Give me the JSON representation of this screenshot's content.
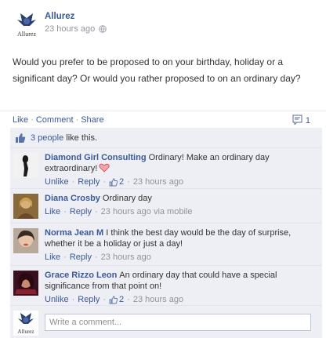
{
  "post": {
    "author": "Allurez",
    "avatar_wordmark": "Allurez",
    "time": "23 hours ago",
    "privacy_icon": "globe-icon",
    "body": "Would you prefer to be proposed to on your birthday, holiday or a significant day? Or would you rather proposed to on an ordinary day?"
  },
  "actions": {
    "like": "Like",
    "comment": "Comment",
    "share": "Share",
    "separator": "·",
    "comment_count": "1",
    "comment_count_icon": "comment-bubble-icon"
  },
  "likes": {
    "icon": "thumbs-up-icon",
    "people": "3 people",
    "suffix": "like this."
  },
  "comments": [
    {
      "author": "Diamond Girl Consulting",
      "text": "Ordinary! Make an ordinary day extraordinary!",
      "emoticon": "heart-icon",
      "actions": [
        "Unlike",
        "Reply"
      ],
      "like_count": "2",
      "time": "23 hours ago",
      "via": ""
    },
    {
      "author": "Diana Crosby",
      "text": "Ordinary day",
      "actions": [
        "Like",
        "Reply"
      ],
      "like_count": "",
      "time": "23 hours ago",
      "via": "via mobile"
    },
    {
      "author": "Norma Jean M",
      "text": "I think the best day would be the day of surprise, whether it be a holiday or just a day!",
      "actions": [
        "Like",
        "Reply"
      ],
      "like_count": "",
      "time": "23 hours ago",
      "via": ""
    },
    {
      "author": "Grace Rizzo Leon",
      "text": "An ordinary day that could have a special significance from that point on!",
      "actions": [
        "Unlike",
        "Reply"
      ],
      "like_count": "2",
      "time": "23 hours ago",
      "via": ""
    }
  ],
  "composer": {
    "placeholder": "Write a comment..."
  },
  "colors": {
    "link": "#3b5998",
    "meta": "#90949c",
    "ufi_background": "#edeff4"
  }
}
